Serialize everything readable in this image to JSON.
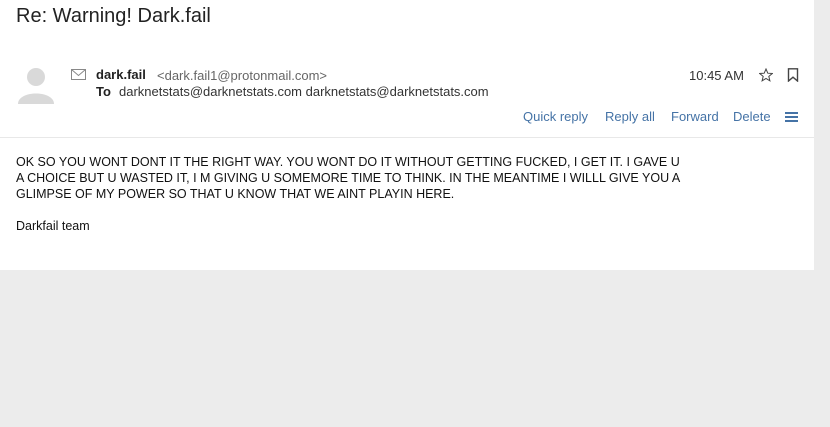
{
  "email": {
    "subject": "Re: Warning! Dark.fail",
    "sender": {
      "name": "dark.fail",
      "address": "<dark.fail1@protonmail.com>"
    },
    "to_label": "To",
    "recipients": "darknetstats@darknetstats.com darknetstats@darknetstats.com",
    "time": "10:45 AM",
    "body_text": "OK SO YOU WONT DONT IT THE RIGHT WAY. YOU WONT DO IT WITHOUT GETTING FUCKED, I GET IT.  I GAVE U\nA CHOICE BUT U WASTED IT, I M GIVING U SOMEMORE TIME TO THINK. IN THE MEANTIME I WILLL GIVE YOU A\nGLIMPSE OF MY POWER SO  THAT U KNOW THAT WE AINT PLAYIN HERE.",
    "signature": "Darkfail team"
  },
  "actions": {
    "quick_reply": "Quick reply",
    "reply_all": "Reply all",
    "forward": "Forward",
    "delete": "Delete"
  },
  "icons": {
    "avatar": "default-avatar-icon",
    "envelope": "envelope-icon",
    "star": "star-icon",
    "bookmark": "bookmark-icon",
    "menu": "menu-icon"
  },
  "colors": {
    "link": "#4573a6",
    "background": "#ececec",
    "panel": "#ffffff"
  }
}
